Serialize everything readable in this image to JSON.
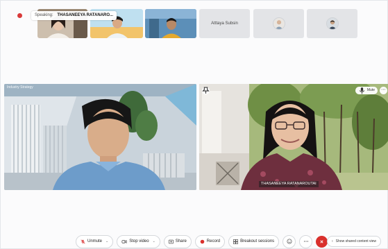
{
  "speaking": {
    "label": "Speaking:",
    "name": "THASANEEYA RATANARO..."
  },
  "thumbnails": [
    {
      "kind": "video",
      "label": ""
    },
    {
      "kind": "video",
      "label": ""
    },
    {
      "kind": "video",
      "label": ""
    },
    {
      "kind": "name",
      "label": "Atttaya Subsin"
    },
    {
      "kind": "avatar",
      "label": ""
    },
    {
      "kind": "avatar",
      "label": ""
    }
  ],
  "tiles": {
    "left": {
      "caption": "Industry Strategy"
    },
    "right": {
      "name": "THASANEEYA RATANAROUTAI",
      "mute_label": "Mute"
    }
  },
  "toolbar": {
    "unmute": "Unmute",
    "stop_video": "Stop video",
    "share": "Share",
    "record": "Record",
    "breakout": "Breakout sessions"
  },
  "shared_view": "Show shared content view",
  "colors": {
    "record": "#d9302c",
    "end_call": "#d9302c",
    "mute_icon": "#d93a3a"
  }
}
